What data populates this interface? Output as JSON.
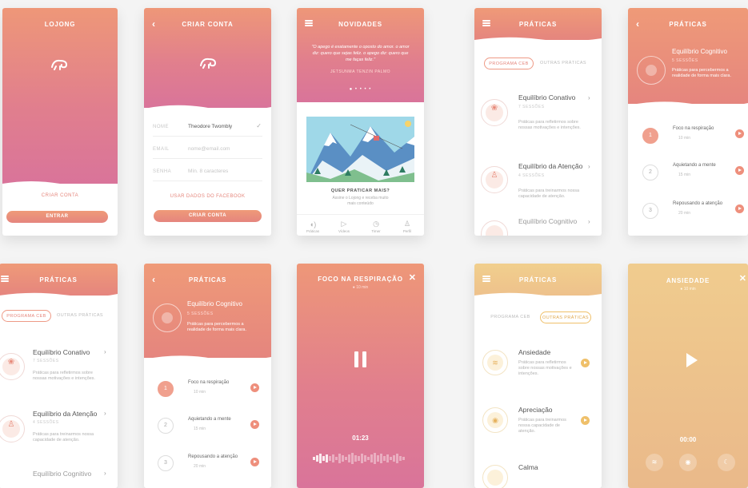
{
  "colors": {
    "accent": "#ee8f7c",
    "pink": "#d9749a",
    "yellow": "#efc06a"
  },
  "s1": {
    "title": "LOJONG",
    "logo": "chameleon-logo",
    "create": "CRIAR CONTA",
    "enter": "ENTRAR"
  },
  "s2": {
    "title": "CRIAR CONTA",
    "fields": [
      {
        "label": "NOME",
        "value": "Theodore Twombly"
      },
      {
        "label": "EMAIL",
        "placeholder": "nome@email.com"
      },
      {
        "label": "SENHA",
        "placeholder": "Mín. 8 caracteres"
      }
    ],
    "facebook": "USAR DADOS DO FACEBOOK",
    "submit": "CRIAR CONTA"
  },
  "s3": {
    "title": "NOVIDADES",
    "quote": "\"O apego é exatamente o oposto do amor. o amor diz: quero que sejas feliz. o apego diz: quero que me faças feliz.\"",
    "author": "JETSUNMA TENZIN PALMO",
    "promo_title": "QUER PRATICAR MAIS?",
    "promo_text": "Assine o Lojong e receba muito mais conteúdo",
    "nav": [
      {
        "icon": "sound-icon",
        "label": "Práticas"
      },
      {
        "icon": "play-icon",
        "label": "Vídeos"
      },
      {
        "icon": "timer-icon",
        "label": "Timer"
      },
      {
        "icon": "user-icon",
        "label": "Perfil"
      }
    ]
  },
  "practices": {
    "title": "PRÁTICAS",
    "tab_ceb": "PROGRAMA CEB",
    "tab_other": "OUTRAS PRÁTICAS",
    "items": [
      {
        "title": "Equilíbrio Conativo",
        "sessions": "7 SESSÕES",
        "desc": "Práticas para refletirmos sobre nossas motivações e intenções."
      },
      {
        "title": "Equilíbrio da Atenção",
        "sessions": "4 SESSÕES",
        "desc": "Práticas para treinarmos nossa capacidade de atenção."
      },
      {
        "title": "Equilíbrio Cognitivo",
        "sessions": "",
        "desc": ""
      }
    ]
  },
  "cognitivo": {
    "title": "PRÁTICAS",
    "name": "Equilíbrio Cognitivo",
    "sessions": "5 SESSÕES",
    "desc": "Práticas para percebermos a realidade de forma mais clara.",
    "steps": [
      {
        "n": "1",
        "name": "Foco na respiração",
        "time": "10 min",
        "done": true
      },
      {
        "n": "2",
        "name": "Aquietando a mente",
        "time": "15 min",
        "done": false
      },
      {
        "n": "3",
        "name": "Repousando a atenção",
        "time": "20 min",
        "done": false
      }
    ]
  },
  "player": {
    "title": "FOCO NA RESPIRAÇÃO",
    "duration": "10 min",
    "time": "01:23"
  },
  "other": {
    "title": "PRÁTICAS",
    "tab_ceb": "PROGRAMA CEB",
    "tab_other": "OUTRAS PRÁTICAS",
    "items": [
      {
        "title": "Ansiedade",
        "desc": "Práticas para refletirmos sobre nossas motivações e intenções."
      },
      {
        "title": "Apreciação",
        "desc": "Práticas para treinarmos nossa capacidade de atenção."
      },
      {
        "title": "Calma",
        "desc": ""
      }
    ]
  },
  "anxiety": {
    "title": "ANSIEDADE",
    "duration": "10 min",
    "time": "00:00"
  }
}
